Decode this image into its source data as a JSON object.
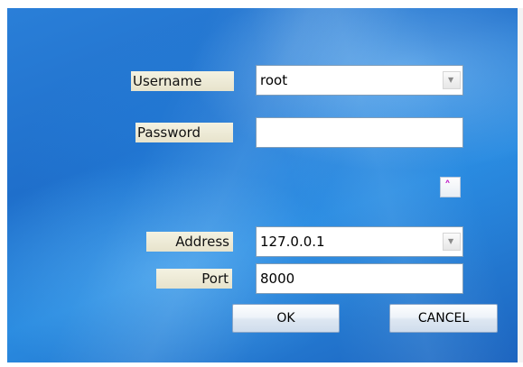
{
  "form": {
    "username_label": "Username",
    "username_value": "root",
    "password_label": "Password",
    "password_value": "",
    "address_label": "Address",
    "address_value": "127.0.0.1",
    "port_label": "Port",
    "port_value": "8000"
  },
  "buttons": {
    "ok_label": "OK",
    "cancel_label": "CANCEL"
  },
  "icons": {
    "dropdown": "chevron-down-icon",
    "collapse": "double-chevron-up-icon"
  },
  "colors": {
    "background": "#2a7fd8",
    "label_bg": "#f0eedb",
    "collapse_icon": "#c020c8"
  }
}
